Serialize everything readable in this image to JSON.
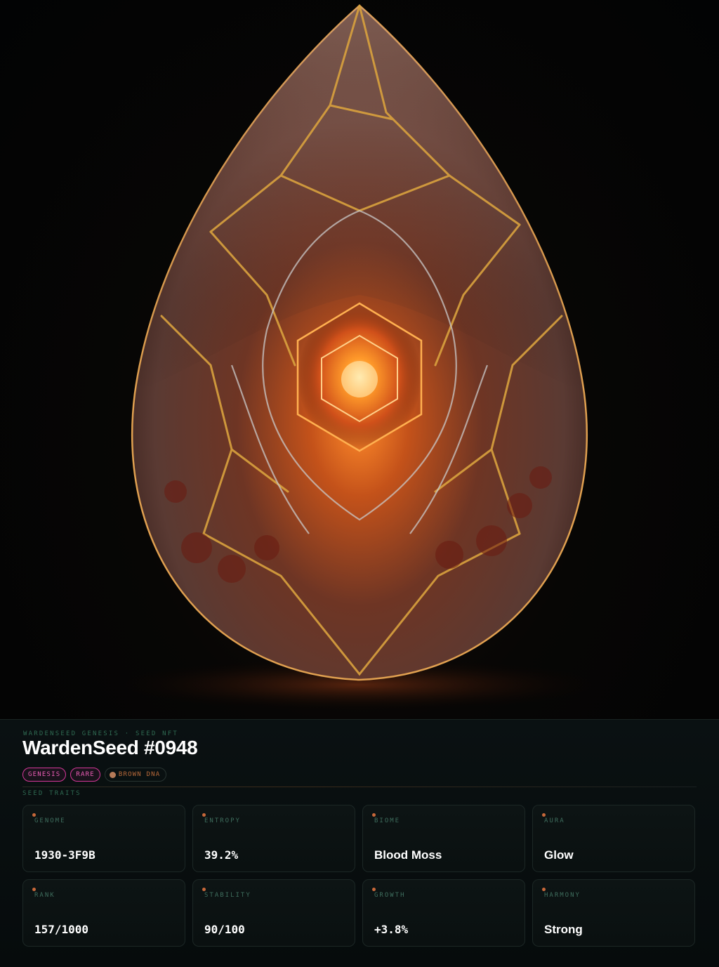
{
  "header": {
    "eyebrow": "WARDENSEED GENESIS · SEED NFT",
    "title": "WardenSeed #0948"
  },
  "tags": [
    {
      "label": "GENESIS"
    },
    {
      "label": "RARE"
    },
    {
      "label": "BROWN DNA"
    }
  ],
  "traits_section": {
    "label": "SEED TRAITS"
  },
  "traits": [
    {
      "label": "GENOME",
      "value": "1930-3F9B"
    },
    {
      "label": "ENTROPY",
      "value": "39.2%"
    },
    {
      "label": "BIOME",
      "value": "Blood Moss"
    },
    {
      "label": "AURA",
      "value": "Glow"
    },
    {
      "label": "RANK",
      "value": "157/1000"
    },
    {
      "label": "STABILITY",
      "value": "90/100"
    },
    {
      "label": "GROWTH",
      "value": "+3.8%"
    },
    {
      "label": "HARMONY",
      "value": "Strong"
    }
  ],
  "colors": {
    "accent_pink": "#d6389a",
    "accent_green": "#2f6a52",
    "dna_brown": "#b57a58",
    "trait_dot": "#c8683a"
  }
}
